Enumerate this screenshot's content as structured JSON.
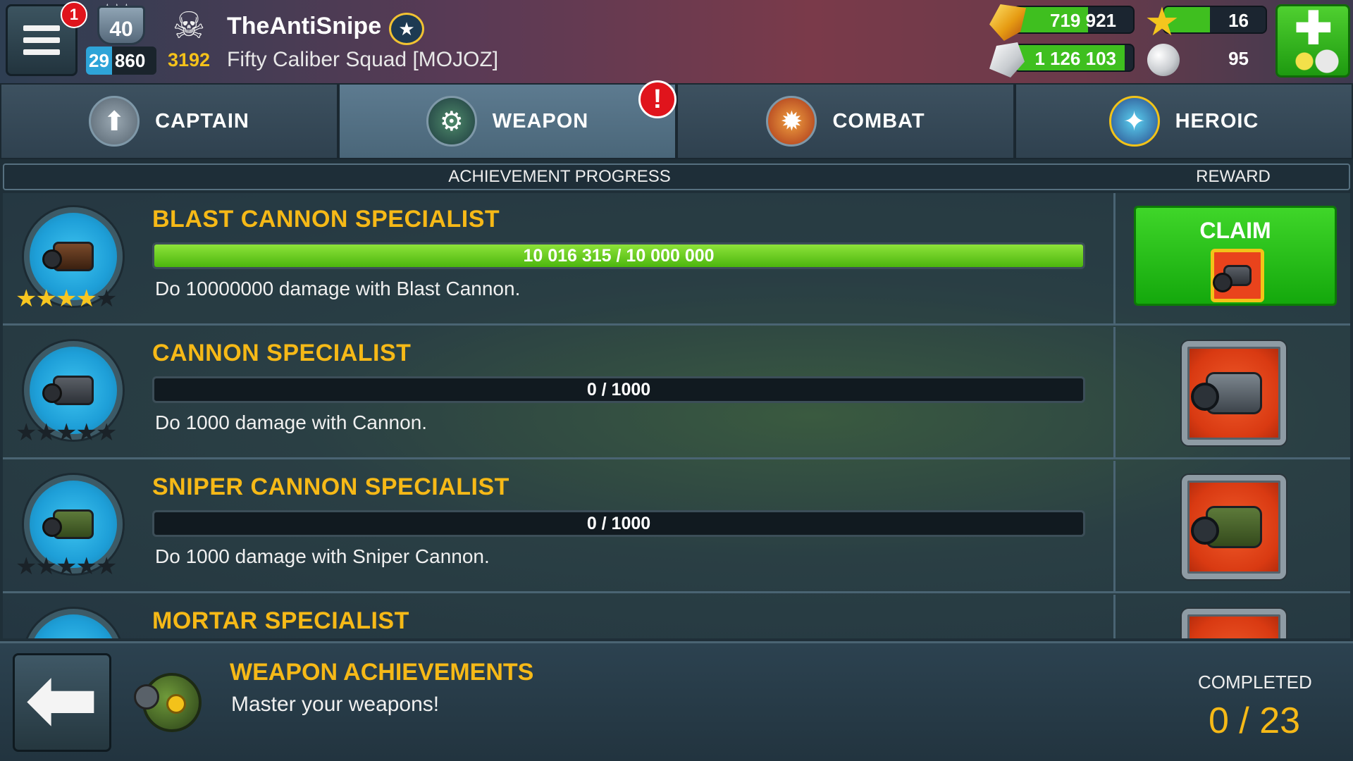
{
  "header": {
    "notifications": "1",
    "level": "40",
    "level_stars": "★★★",
    "xp_a": "29",
    "xp_b": "860",
    "kills": "3192",
    "player_name": "TheAntiSnipe",
    "clan": "Fifty Caliber Squad [MOJOZ]",
    "gold": "719 921",
    "gold_fill": 0.62,
    "silver": "1 126 103",
    "silver_fill": 0.93,
    "stars": "16",
    "star_fill": 0.45,
    "pearls": "95",
    "shop_plus": "✚"
  },
  "tabs": [
    {
      "label": "CAPTAIN",
      "icon": "captain-badge-icon",
      "active": false
    },
    {
      "label": "WEAPON",
      "icon": "weapon-robot-icon",
      "active": true
    },
    {
      "label": "COMBAT",
      "icon": "combat-explosion-icon",
      "active": false
    },
    {
      "label": "HEROIC",
      "icon": "heroic-stars-icon",
      "active": false
    }
  ],
  "tab_alert": "!",
  "table": {
    "progress_header": "ACHIEVEMENT PROGRESS",
    "reward_header": "REWARD"
  },
  "achievements": [
    {
      "title": "BLAST CANNON SPECIALIST",
      "progress_text": "10 016 315 / 10 000 000",
      "progress": 1.0,
      "description": "Do 10000000 damage with Blast Cannon.",
      "stars_earned": 4,
      "stars_total": 5,
      "claim_label": "CLAIM"
    },
    {
      "title": "CANNON SPECIALIST",
      "progress_text": "0 / 1000",
      "progress": 0.0,
      "description": "Do 1000 damage with Cannon.",
      "stars_earned": 0,
      "stars_total": 5
    },
    {
      "title": "SNIPER CANNON SPECIALIST",
      "progress_text": "0 / 1000",
      "progress": 0.0,
      "description": "Do 1000 damage with Sniper Cannon.",
      "stars_earned": 0,
      "stars_total": 5
    },
    {
      "title": "MORTAR SPECIALIST",
      "progress_text": "",
      "progress": 0.0,
      "description": "",
      "stars_earned": 0,
      "stars_total": 5
    }
  ],
  "footer": {
    "title": "WEAPON ACHIEVEMENTS",
    "subtitle": "Master your weapons!",
    "completed_label": "COMPLETED",
    "completed_value": "0 / 23"
  },
  "colors": {
    "accent_gold": "#f6b917",
    "claim_green": "#14a80c",
    "progress_green": "#4cb60e",
    "alert_red": "#e0141c"
  }
}
